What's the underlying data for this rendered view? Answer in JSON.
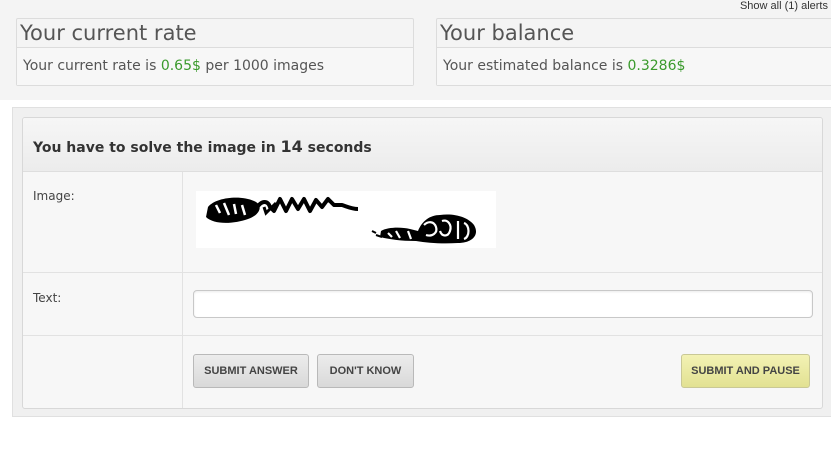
{
  "header": {
    "alerts_link": "Show all (1) alerts"
  },
  "rate_panel": {
    "title": "Your current rate",
    "text_prefix": "Your current rate is ",
    "rate_value": "0.65$",
    "text_suffix": " per 1000 images"
  },
  "balance_panel": {
    "title": "Your balance",
    "text_prefix": "Your estimated balance is ",
    "balance_value": "0.3286$"
  },
  "solve_box": {
    "header_prefix": "You have to solve the image in ",
    "seconds": "14",
    "header_suffix": " seconds",
    "image_label": "Image:",
    "text_label": "Text:",
    "text_input_value": "",
    "buttons": {
      "submit_answer": "SUBMIT ANSWER",
      "dont_know": "DON'T KNOW",
      "submit_and_pause": "SUBMIT AND PAUSE"
    }
  },
  "colors": {
    "accent_green": "#3a9a2c",
    "button_yellow": "#e9e8a0"
  }
}
